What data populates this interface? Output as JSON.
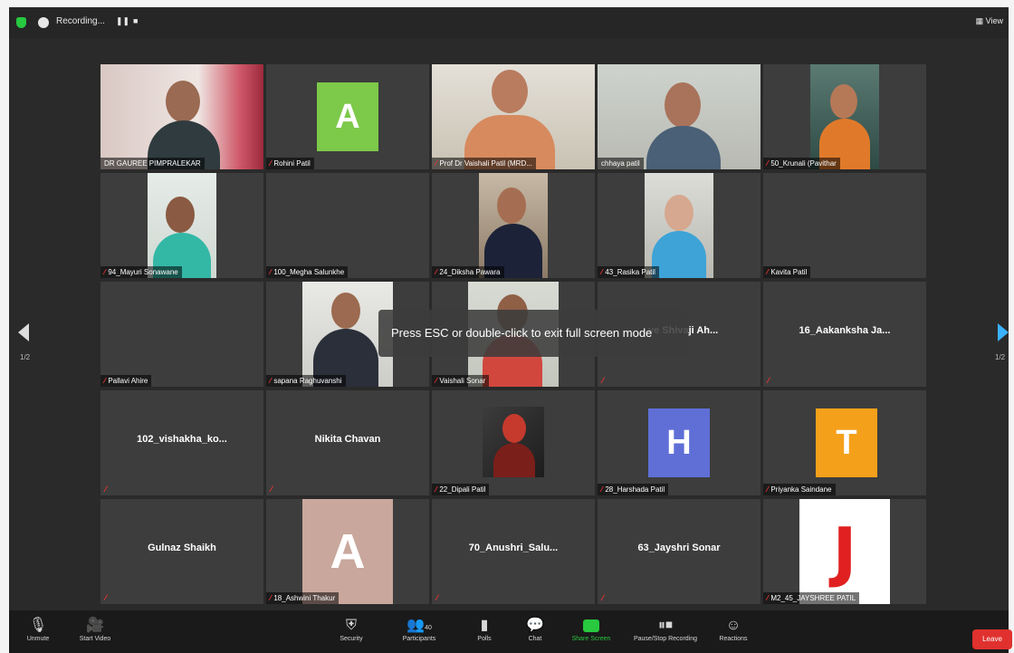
{
  "recording": {
    "label": "Recording...",
    "pause": "❚❚",
    "stop": "■"
  },
  "view_label": "▦ View",
  "pager": {
    "left": "1/2",
    "right": "1/2"
  },
  "toast": "Press ESC or double-click to exit full screen mode",
  "tiles": [
    {
      "name": "DR GAUREE PIMPRALEKAR",
      "muted": false
    },
    {
      "name": "Rohini Patil",
      "muted": true,
      "letter": "A",
      "avatar_color": "#7dc94a"
    },
    {
      "name": "Prof Dr Vaishali Patil (MRD...",
      "muted": true
    },
    {
      "name": "chhaya patil",
      "muted": false,
      "active": true
    },
    {
      "name": "50_Krunali (Pavithar",
      "muted": true
    },
    {
      "name": "94_Mayuri Sonawane",
      "muted": true
    },
    {
      "name": "100_Megha Salunkhe",
      "muted": true
    },
    {
      "name": "24_Diksha Pawara",
      "muted": true
    },
    {
      "name": "43_Rasika Patil",
      "muted": true
    },
    {
      "name": "Kavita Patil",
      "muted": true
    },
    {
      "name": "Pallavi Ahire",
      "muted": true
    },
    {
      "name": "sapana Raghuvanshi",
      "muted": true
    },
    {
      "name": "Vaishali Sonar",
      "muted": true
    },
    {
      "big": "...ye Shivaji Ah..."
    },
    {
      "big": "16_Aakanksha Ja..."
    },
    {
      "big": "102_vishakha_ko..."
    },
    {
      "big": "Nikita Chavan"
    },
    {
      "name": "22_Dipali Patil",
      "muted": true
    },
    {
      "name": "28_Harshada Patil",
      "muted": true,
      "letter": "H",
      "avatar_color": "#5f6fd6"
    },
    {
      "name": "Priyanka Saindane",
      "muted": true,
      "letter": "T",
      "avatar_color": "#f5a01a"
    },
    {
      "big": "Gulnaz Shaikh"
    },
    {
      "name": "18_Ashwini Thakur",
      "muted": true,
      "letter": "A",
      "avatar_color": "#c9a79c"
    },
    {
      "big": "70_Anushri_Salu..."
    },
    {
      "big": "63_Jayshri Sonar"
    },
    {
      "name": "M2_45_JAYSHREE PATIL",
      "muted": true,
      "letter": "J",
      "avatar_color": "#ffffff",
      "letter_color": "#e02020"
    }
  ],
  "toolbar": {
    "unmute": "Unmute",
    "start_video": "Start Video",
    "security": "Security",
    "participants": "Participants",
    "participants_count": "40",
    "polls": "Polls",
    "chat": "Chat",
    "share_screen": "Share Screen",
    "pause_stop_recording": "Pause/Stop Recording",
    "reactions": "Reactions",
    "leave": "Leave"
  },
  "colors": {
    "share_green": "#28c83f",
    "leave_red": "#e0312e",
    "active_outline": "#d7e95b",
    "pager_blue": "#3ab2ff"
  }
}
